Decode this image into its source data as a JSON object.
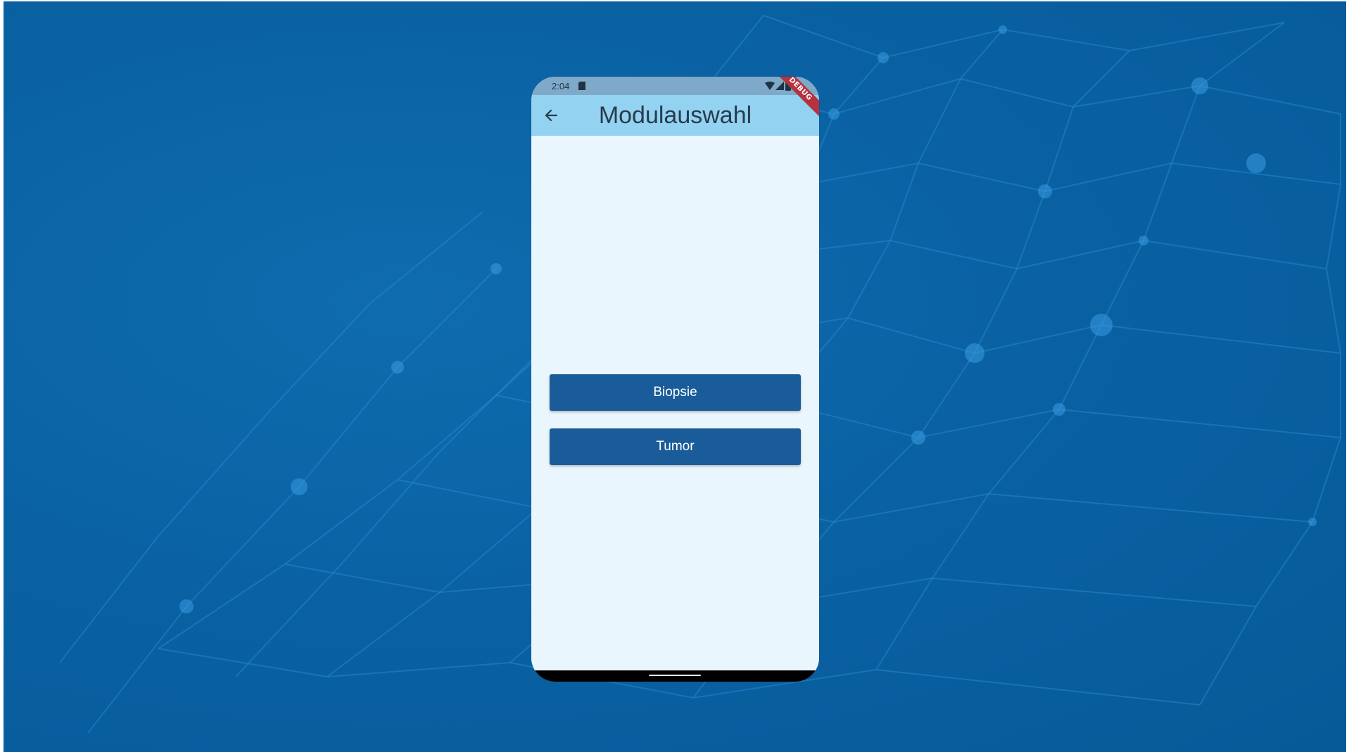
{
  "status_bar": {
    "time": "2:04",
    "icons": [
      "sd-card-icon",
      "wifi-icon",
      "signal-icon",
      "battery-icon"
    ]
  },
  "app_bar": {
    "title": "Modulauswahl",
    "back_icon": "back-arrow-icon",
    "debug_banner": "DEBUG"
  },
  "modules": {
    "biopsie_label": "Biopsie",
    "tumor_label": "Tumor"
  },
  "colors": {
    "background": "#0a62a3",
    "app_bar": "#94d2f1",
    "status_bar": "#7fa9c8",
    "content": "#eaf6fd",
    "button": "#1a5c9a",
    "debug_banner": "#b7323f"
  }
}
